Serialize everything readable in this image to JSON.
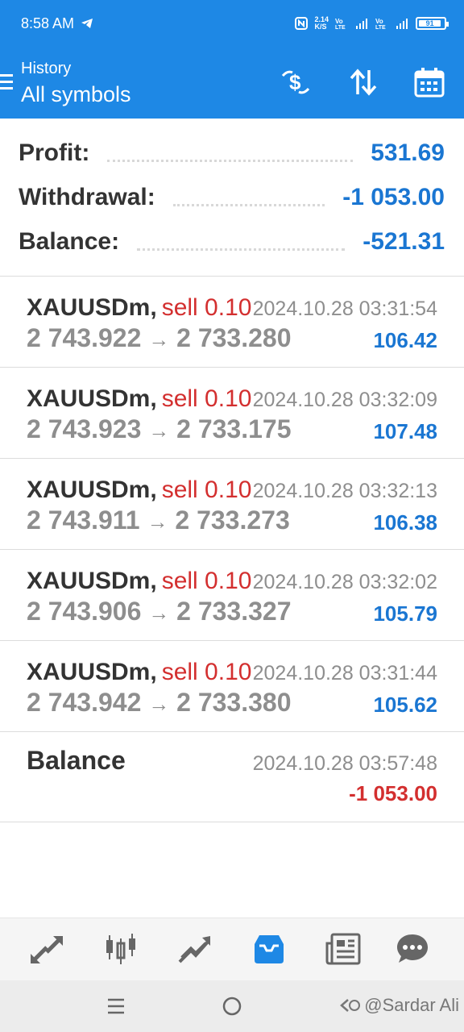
{
  "status": {
    "time": "8:58 AM",
    "battery": "91",
    "speed_top": "2.14",
    "speed_bottom": "K/S"
  },
  "header": {
    "subtitle": "History",
    "title": "All symbols"
  },
  "summary": [
    {
      "label": "Profit:",
      "value": "531.69"
    },
    {
      "label": "Withdrawal:",
      "value": "-1 053.00"
    },
    {
      "label": "Balance:",
      "value": "-521.31"
    }
  ],
  "trades": [
    {
      "symbol": "XAUUSDm,",
      "side": "sell 0.10",
      "time": "2024.10.28 03:31:54",
      "open": "2 743.922",
      "close": "2 733.280",
      "profit": "106.42"
    },
    {
      "symbol": "XAUUSDm,",
      "side": "sell 0.10",
      "time": "2024.10.28 03:32:09",
      "open": "2 743.923",
      "close": "2 733.175",
      "profit": "107.48"
    },
    {
      "symbol": "XAUUSDm,",
      "side": "sell 0.10",
      "time": "2024.10.28 03:32:13",
      "open": "2 743.911",
      "close": "2 733.273",
      "profit": "106.38"
    },
    {
      "symbol": "XAUUSDm,",
      "side": "sell 0.10",
      "time": "2024.10.28 03:32:02",
      "open": "2 743.906",
      "close": "2 733.327",
      "profit": "105.79"
    },
    {
      "symbol": "XAUUSDm,",
      "side": "sell 0.10",
      "time": "2024.10.28 03:31:44",
      "open": "2 743.942",
      "close": "2 733.380",
      "profit": "105.62"
    }
  ],
  "balance_entry": {
    "label": "Balance",
    "time": "2024.10.28 03:57:48",
    "amount": "-1 053.00"
  },
  "arrow": "→",
  "tabs": [
    "quotes-icon",
    "chart-icon",
    "trade-icon",
    "history-icon",
    "news-icon",
    "chat-icon"
  ],
  "watermark": "@Sardar Ali",
  "colors": {
    "accent": "#1e88e5",
    "profit": "#1a76d2",
    "loss": "#d32f2f"
  }
}
